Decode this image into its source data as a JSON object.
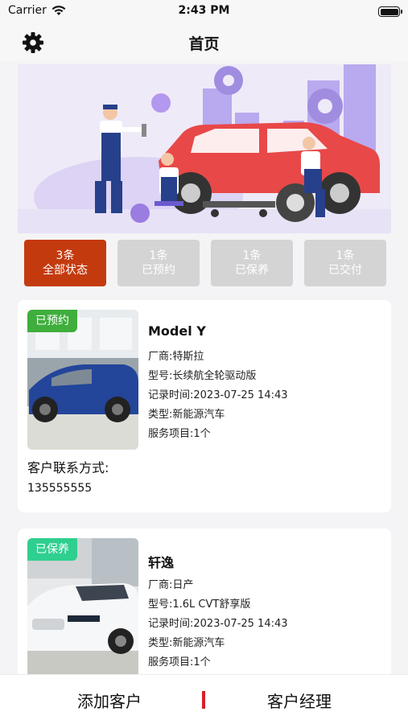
{
  "status": {
    "carrier": "Carrier",
    "time": "2:43 PM"
  },
  "nav": {
    "title": "首页"
  },
  "filters": [
    {
      "count": "3条",
      "label": "全部状态"
    },
    {
      "count": "1条",
      "label": "已预约"
    },
    {
      "count": "1条",
      "label": "已保养"
    },
    {
      "count": "1条",
      "label": "已交付"
    }
  ],
  "records": [
    {
      "status": "已预约",
      "status_color": "#3fae3d",
      "name": "Model Y",
      "maker": "厂商:特斯拉",
      "model": "型号:长续航全轮驱动版",
      "record_time": "记录时间:2023-07-25 14:43",
      "type": "类型:新能源汽车",
      "services": "服务项目:1个",
      "contact_label": "客户联系方式:",
      "contact": "135555555"
    },
    {
      "status": "已保养",
      "status_color": "#2fcf8f",
      "name": "轩逸",
      "maker": "厂商:日产",
      "model": "型号:1.6L CVT舒享版",
      "record_time": "记录时间:2023-07-25 14:43",
      "type": "类型:新能源汽车",
      "services": "服务项目:1个"
    }
  ],
  "bottom": {
    "add_customer": "添加客户",
    "manager": "客户经理"
  },
  "colors": {
    "accent": "#c43a0f",
    "divider": "#d6202a"
  },
  "icons": {
    "settings": "gear-icon",
    "wifi": "wifi-icon",
    "battery": "battery-icon"
  }
}
